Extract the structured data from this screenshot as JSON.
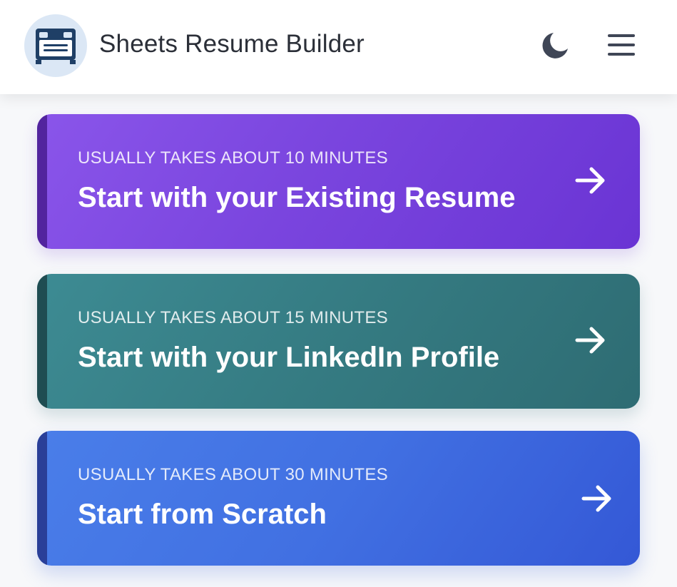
{
  "header": {
    "app_title": "Sheets Resume Builder",
    "logo_icon": "bed-logo-icon",
    "theme_toggle_icon": "moon-icon",
    "menu_icon": "hamburger-menu-icon"
  },
  "options": [
    {
      "subtitle": "USUALLY TAKES ABOUT 10 MINUTES",
      "title": "Start with your Existing Resume",
      "icon": "arrow-right-icon",
      "color": "#7a45de"
    },
    {
      "subtitle": "USUALLY TAKES ABOUT 15 MINUTES",
      "title": "Start with your LinkedIn Profile",
      "icon": "arrow-right-icon",
      "color": "#357b82"
    },
    {
      "subtitle": "USUALLY TAKES ABOUT 30 MINUTES",
      "title": "Start from Scratch",
      "icon": "arrow-right-icon",
      "color": "#4170e2"
    }
  ],
  "colors": {
    "header_text": "#2b2f38",
    "icon_dark": "#3f4656",
    "logo_bg": "#dbe7f5",
    "logo_fg": "#1f3f66"
  }
}
